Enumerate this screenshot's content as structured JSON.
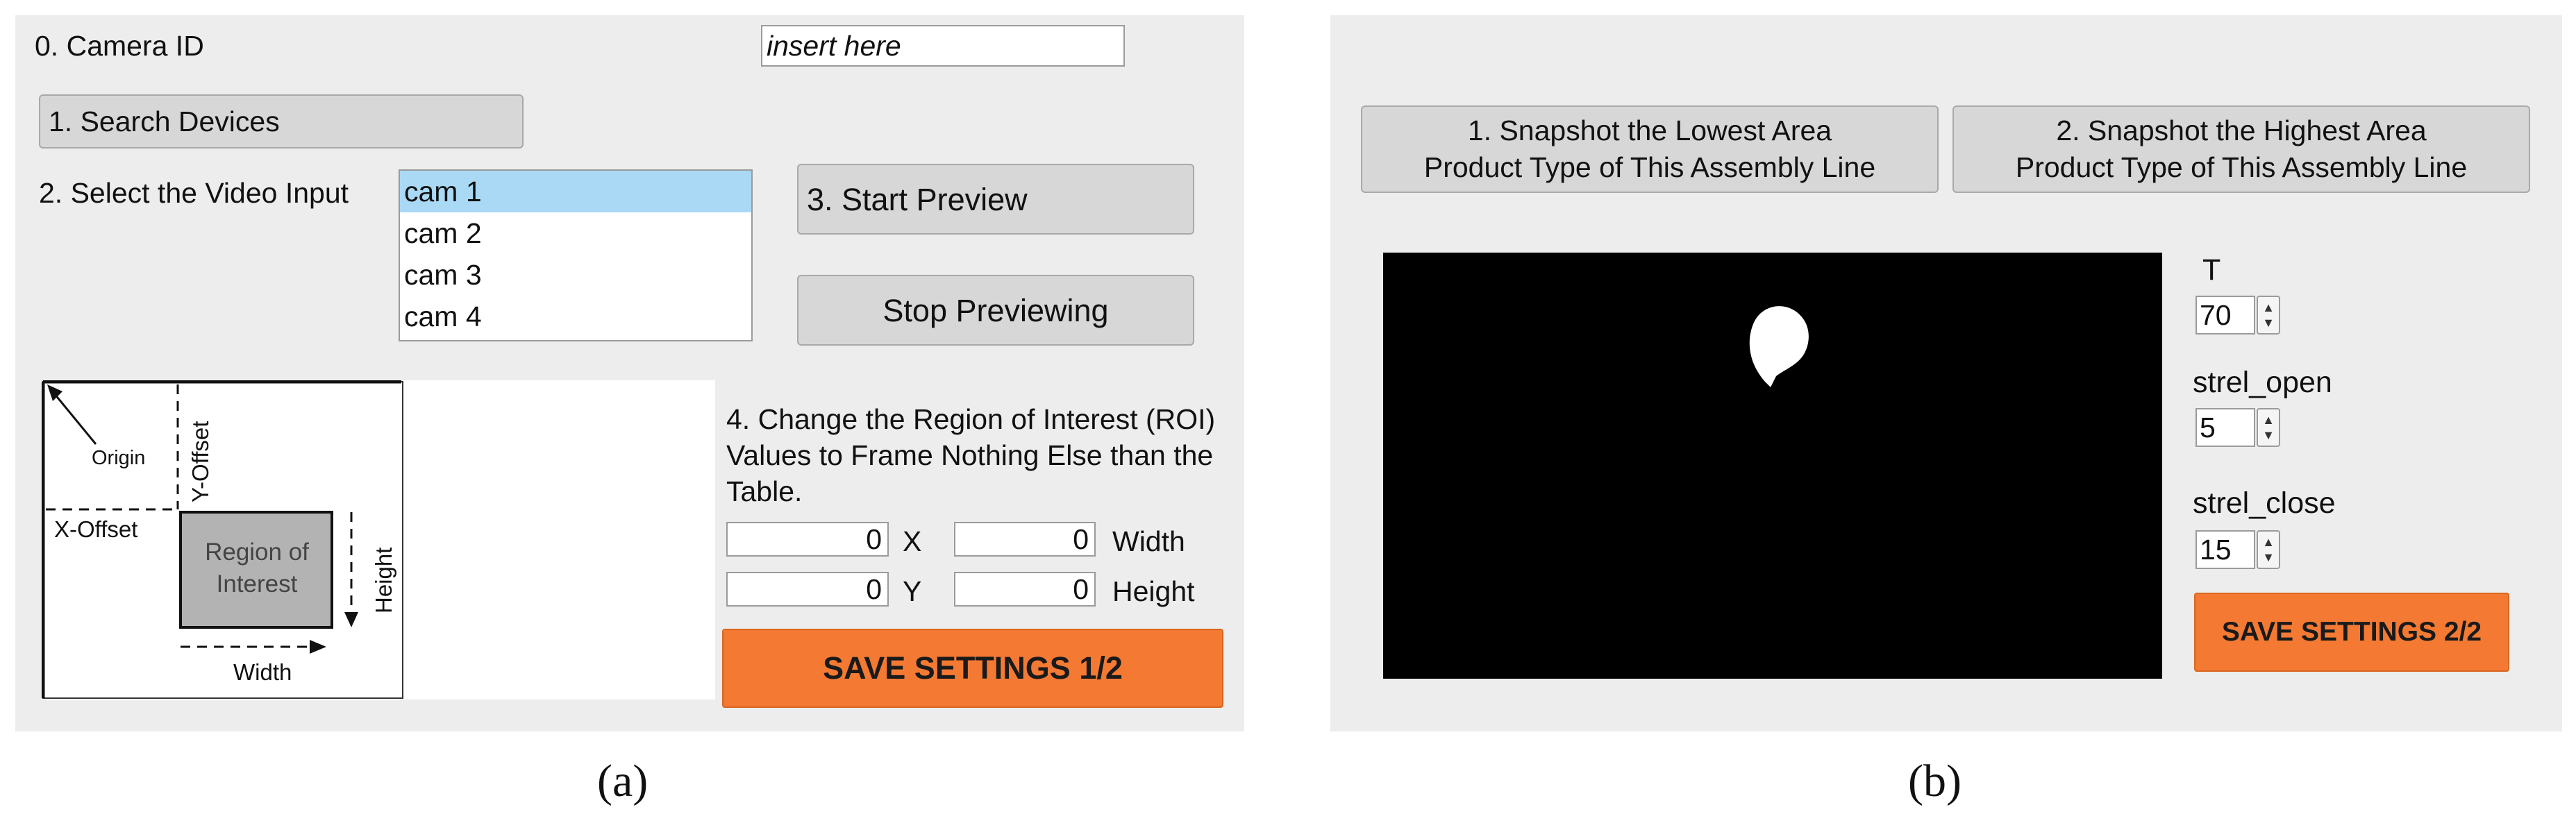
{
  "panel_a": {
    "camera_id_label": "0. Camera ID",
    "camera_id_placeholder": "insert here",
    "search_devices_button": "1. Search Devices",
    "select_video_label": "2. Select the Video Input",
    "video_inputs": [
      "cam 1",
      "cam 2",
      "cam 3",
      "cam 4"
    ],
    "selected_video_input": "cam 1",
    "start_preview_button": "3. Start Preview",
    "stop_previewing_button": "Stop Previewing",
    "diagram": {
      "origin": "Origin",
      "y_offset": "Y-Offset",
      "x_offset": "X-Offset",
      "roi_line1": "Region of",
      "roi_line2": "Interest",
      "height": "Height",
      "width": "Width"
    },
    "roi_instructions": [
      "4. Change the Region of Interest (ROI)",
      "Values to Frame Nothing Else than the",
      "Table."
    ],
    "roi_fields": {
      "x_value": "0",
      "x_label": "X",
      "y_value": "0",
      "y_label": "Y",
      "width_value": "0",
      "width_label": "Width",
      "height_value": "0",
      "height_label": "Height"
    },
    "save_button": "SAVE SETTINGS 1/2",
    "caption": "(a)"
  },
  "panel_b": {
    "snapshot_lowest_button": [
      "1. Snapshot the Lowest Area",
      "Product Type of This Assembly Line"
    ],
    "snapshot_highest_button": [
      "2. Snapshot the Highest Area",
      "Product Type of This Assembly Line"
    ],
    "params": [
      {
        "label": "T",
        "value": "70"
      },
      {
        "label": "strel_open",
        "value": "5"
      },
      {
        "label": "strel_close",
        "value": "15"
      }
    ],
    "save_button": "SAVE SETTINGS 2/2",
    "caption": "(b)"
  },
  "colors": {
    "panel_bg": "#ededed",
    "accent_orange": "#f47a33",
    "selection_blue": "#a9d9f5",
    "preview_bg": "#000000"
  },
  "icons": {
    "spinner": "up-down-arrows-icon"
  }
}
